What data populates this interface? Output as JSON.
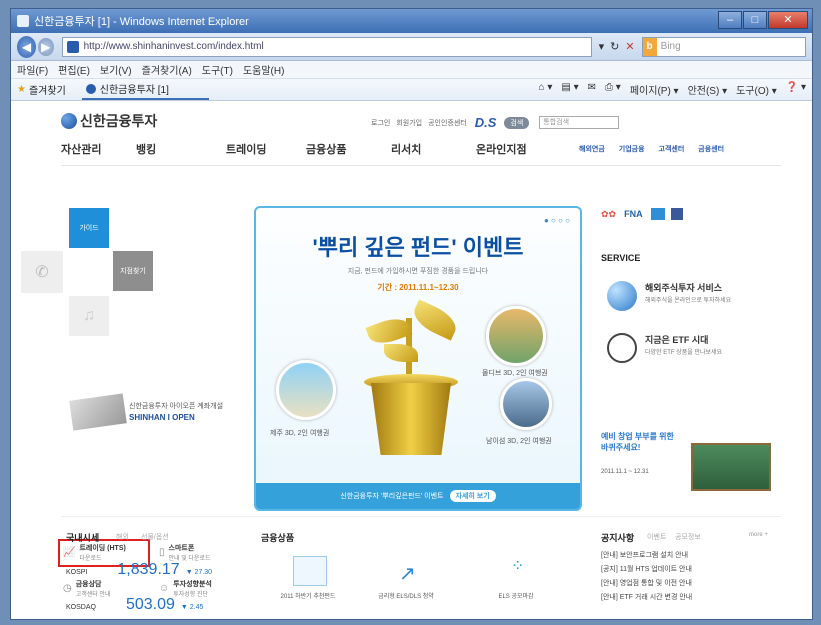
{
  "window": {
    "title": "신한금융투자 [1] - Windows Internet Explorer",
    "min": "–",
    "max": "□",
    "close": "✕"
  },
  "address": {
    "url": "http://www.shinhaninvest.com/index.html",
    "search_placeholder": "Bing",
    "search_brand": "b"
  },
  "menu": [
    "파일(F)",
    "편집(E)",
    "보기(V)",
    "즐겨찾기(A)",
    "도구(T)",
    "도움말(H)"
  ],
  "favbar": {
    "favorites": "즐겨찾기",
    "tab": "신한금융투자 [1]",
    "commands": [
      "페이지(P) ▾",
      "안전(S) ▾",
      "도구(O) ▾",
      "❓ ▾"
    ]
  },
  "site": {
    "logo": "신한금융투자",
    "toplinks": [
      "로그인",
      "회원가입",
      "공인인증센터"
    ],
    "dis": "D.S",
    "pill": "검색",
    "search_placeholder": "통합검색",
    "gnb": [
      "자산관리",
      "뱅킹",
      "트레이딩",
      "금융상품",
      "리서치",
      "온라인지점"
    ],
    "subgnb": [
      "해외연금",
      "기업금융",
      "고객센터",
      "금융센터"
    ],
    "tiles": [
      "가이드",
      "지점찾기"
    ],
    "banner": {
      "title": "'뿌리 깊은 펀드' 이벤트",
      "sub": "지금, 펀드에 가입하시면 푸짐한 경품을 드립니다",
      "period": "기간 : 2011.11.1~12.30",
      "cap1": "제주 3D, 2인 여행권",
      "cap2": "몰디브 3D, 2인 여행권",
      "cap3": "남이섬 3D, 2인 여행권",
      "btm": "신한금융투자 '뿌리깊은펀드' 이벤트",
      "go": "자세히 보기",
      "dots": "● ○ ○ ○"
    },
    "promo": {
      "brand": "SHINHAN I OPEN",
      "desc": "신한금융투자 아이오픈 계좌개설"
    },
    "quick": [
      {
        "label": "트레이딩 (HTS)",
        "sub": "다운로드"
      },
      {
        "label": "스마트폰",
        "sub": "안내 및 다운로드"
      },
      {
        "label": "금융상담",
        "sub": "고객센터 안내"
      },
      {
        "label": "투자성향분석",
        "sub": "투자성향 진단"
      }
    ],
    "right": {
      "brands": "FNA",
      "service": "SERVICE",
      "svc1": "해외주식투자 서비스",
      "svc1sub": "해외주식을 온라인으로 투자하세요",
      "svc2": "지금은 ETF 시대",
      "svc2sub": "다양한 ETF 상품을 만나보세요",
      "promo2": "예비 창업 부부를 위한 바퀴주세요!",
      "promo2date": "2011.11.1 ~ 12.31"
    },
    "bottom": {
      "market_title": "국내시세",
      "market_tabs": [
        "해외",
        "선물/옵션"
      ],
      "rows": [
        {
          "name": "KOSPI",
          "value": "1,839.17",
          "delta": "▼ 27.30"
        },
        {
          "name": "KOSDAQ",
          "value": "503.09",
          "delta": "▼ 2.45"
        }
      ],
      "products_title": "금융상품",
      "products": [
        "2011 하반기 추천펀드",
        "금리형 ELS/DLS 청약",
        "ELS 공모마감"
      ],
      "notice_title": "공지사항",
      "notice_tabs": [
        "이벤트",
        "공모정보"
      ],
      "more": "more +",
      "news": [
        "[안내] 보안프로그램 설치 안내",
        "[공지] 11월 HTS 업데이트 안내",
        "[안내] 영업점 통합 및 이전 안내",
        "[안내] ETF 거래 시간 변경 안내"
      ]
    }
  }
}
